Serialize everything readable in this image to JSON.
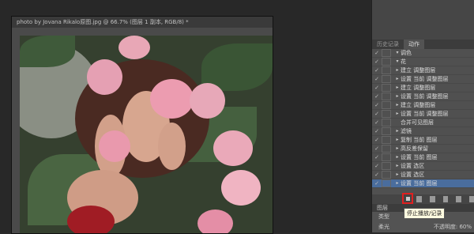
{
  "document": {
    "title": "photo by Jovana Rikalo原图.jpg @ 66.7% (图层 1 副本, RGB/8) *"
  },
  "panel": {
    "tabs": [
      {
        "label": "历史记录"
      },
      {
        "label": "动作"
      }
    ],
    "actions": [
      {
        "check": "✓",
        "tri": "▾",
        "label": "调色"
      },
      {
        "check": "✓",
        "tri": "▾",
        "label": "花"
      },
      {
        "check": "✓",
        "tri": "▸",
        "label": "建立 调整图层"
      },
      {
        "check": "✓",
        "tri": "▸",
        "label": "设置 当前 调整图层"
      },
      {
        "check": "✓",
        "tri": "▸",
        "label": "建立 调整图层"
      },
      {
        "check": "✓",
        "tri": "▸",
        "label": "设置 当前 调整图层"
      },
      {
        "check": "✓",
        "tri": "▸",
        "label": "建立 调整图层"
      },
      {
        "check": "✓",
        "tri": "▸",
        "label": "设置 当前 调整图层"
      },
      {
        "check": "✓",
        "tri": "",
        "label": "合并可见图层"
      },
      {
        "check": "✓",
        "tri": "▸",
        "label": "滤镜"
      },
      {
        "check": "✓",
        "tri": "▸",
        "label": "复制 当前 图层"
      },
      {
        "check": "✓",
        "tri": "▸",
        "label": "高反差保留"
      },
      {
        "check": "✓",
        "tri": "▸",
        "label": "设置 当前 图层"
      },
      {
        "check": "✓",
        "tri": "▸",
        "label": "设置 选区"
      },
      {
        "check": "✓",
        "tri": "▸",
        "label": "设置 选区"
      },
      {
        "check": "✓",
        "tri": "▸",
        "label": "设置 当前 图层"
      }
    ],
    "tooltip": "停止播放/记录",
    "layers_title": "图层",
    "layers_kind": "类型",
    "layers_blend": "柔光",
    "opacity_label": "不透明度:",
    "opacity_value": "60%"
  }
}
